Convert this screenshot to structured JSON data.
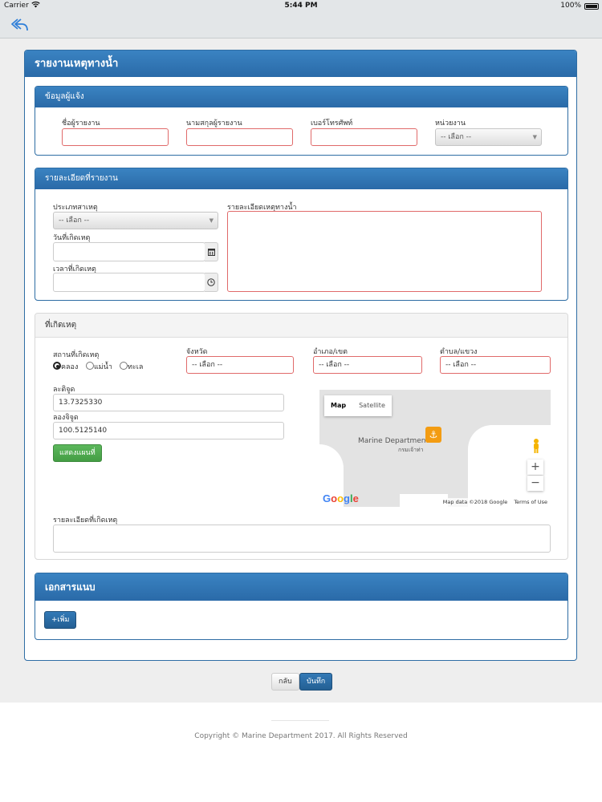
{
  "status_bar": {
    "carrier": "Carrier",
    "time": "5:44 PM",
    "battery": "100%"
  },
  "page": {
    "title": "รายงานเหตุทางน้ำ"
  },
  "reporter": {
    "heading": "ข้อมูลผู้แจ้ง",
    "first_name_label": "ชื่อผู้รายงาน",
    "first_name_value": "",
    "last_name_label": "นามสกุลผู้รายงาน",
    "last_name_value": "",
    "phone_label": "เบอร์โทรศัพท์",
    "phone_value": "",
    "unit_label": "หน่วยงาน",
    "unit_selected": "-- เลือก --"
  },
  "details": {
    "heading": "รายละเอียดที่รายงาน",
    "type_label": "ประเภทสาเหตุ",
    "type_selected": "-- เลือก --",
    "date_label": "วันที่เกิดเหตุ",
    "date_value": "",
    "time_label": "เวลาที่เกิดเหตุ",
    "time_value": "",
    "desc_label": "รายละเอียดเหตุทางน้ำ",
    "desc_value": ""
  },
  "location": {
    "heading": "ที่เกิดเหตุ",
    "place_label": "สถานที่เกิดเหตุ",
    "radio_options": [
      "คลอง",
      "แม่น้ำ",
      "ทะเล"
    ],
    "radio_selected": "คลอง",
    "province_label": "จังหวัด",
    "province_selected": "-- เลือก --",
    "district_label": "อำเภอ/เขต",
    "district_selected": "-- เลือก --",
    "subdistrict_label": "ตำบล/แขวง",
    "subdistrict_selected": "-- เลือก --",
    "lat_label": "ละติจูด",
    "lat_value": "13.7325330",
    "lng_label": "ลองจิจูด",
    "lng_value": "100.5125140",
    "show_map_button": "แสดงแผนที่",
    "incident_detail_label": "รายละเอียดที่เกิดเหตุ",
    "incident_detail_value": ""
  },
  "map": {
    "map_tab": "Map",
    "satellite_tab": "Satellite",
    "place_name": "Marine Department",
    "place_name_thai": "กรมเจ้าท่า",
    "zoom_in": "+",
    "zoom_out": "−",
    "logo": "Google",
    "data_credit": "Map data ©2018 Google",
    "terms": "Terms of Use"
  },
  "attachments": {
    "heading": "เอกสารแนบ",
    "add_button": "+เพิ่ม"
  },
  "actions": {
    "back_button": "กลับ",
    "save_button": "บันทึก"
  },
  "footer": {
    "copyright": "Copyright © Marine Department 2017. All Rights Reserved"
  },
  "colors": {
    "primary": "#2e6da4",
    "error_border": "#e06a6a",
    "success": "#5cb85c",
    "marker": "#f39c12",
    "ios_link": "#2f7fd8"
  }
}
